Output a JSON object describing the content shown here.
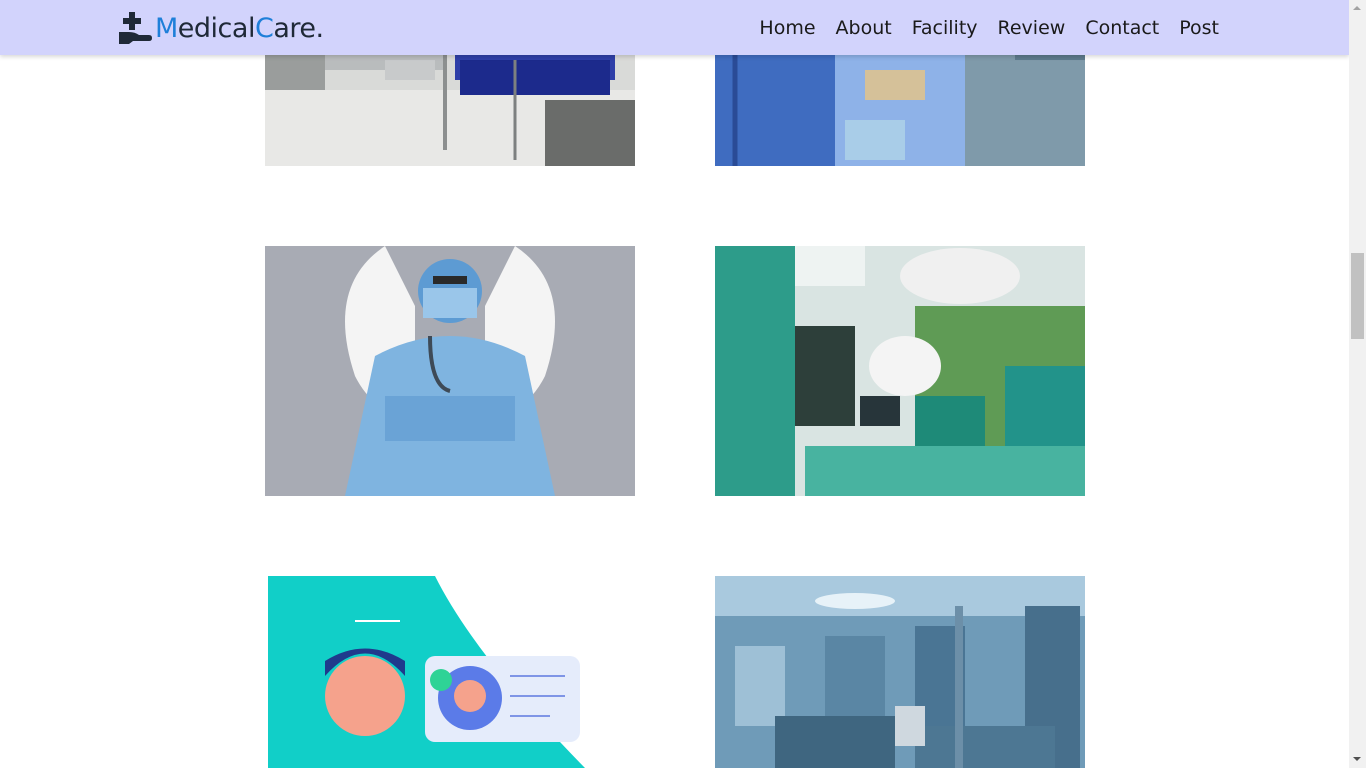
{
  "header": {
    "logo": {
      "part1": "M",
      "part2": "edical",
      "part3": "C",
      "part4": "are."
    },
    "nav": [
      "Home",
      "About",
      "Facility",
      "Review",
      "Contact",
      "Post"
    ]
  },
  "gallery": [
    {
      "name": "hospital-beds-image"
    },
    {
      "name": "surgery-image"
    },
    {
      "name": "angel-nurse-image"
    },
    {
      "name": "operating-room-image"
    },
    {
      "name": "doctor-illustration-image"
    },
    {
      "name": "recovery-ward-image"
    }
  ],
  "colors": {
    "navbar": "#d2d3fc",
    "accent": "#1e7fd9",
    "text": "#1f2937"
  }
}
